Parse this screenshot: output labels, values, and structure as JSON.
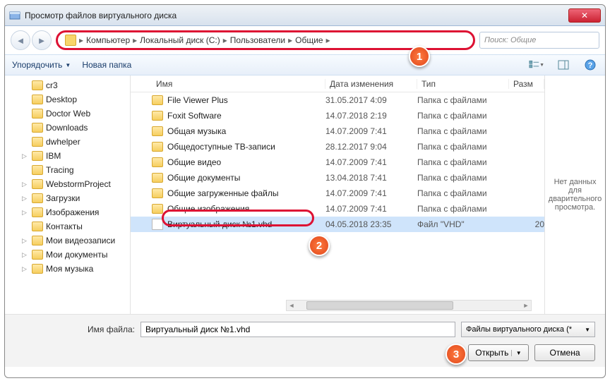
{
  "window": {
    "title": "Просмотр файлов виртуального диска"
  },
  "breadcrumb": [
    "Компьютер",
    "Локальный диск (C:)",
    "Пользователи",
    "Общие"
  ],
  "search": {
    "placeholder": "Поиск: Общие"
  },
  "toolbar": {
    "organize": "Упорядочить",
    "newfolder": "Новая папка"
  },
  "columns": {
    "name": "Имя",
    "modified": "Дата изменения",
    "type": "Тип",
    "size": "Разм"
  },
  "tree": [
    {
      "label": "cr3",
      "lvl": 1
    },
    {
      "label": "Desktop",
      "lvl": 1
    },
    {
      "label": "Doctor Web",
      "lvl": 1
    },
    {
      "label": "Downloads",
      "lvl": 1
    },
    {
      "label": "dwhelper",
      "lvl": 1
    },
    {
      "label": "IBM",
      "lvl": 1,
      "exp": true
    },
    {
      "label": "Tracing",
      "lvl": 1
    },
    {
      "label": "WebstormProject",
      "lvl": 1,
      "exp": true
    },
    {
      "label": "Загрузки",
      "lvl": 1,
      "exp": true
    },
    {
      "label": "Изображения",
      "lvl": 1,
      "exp": true
    },
    {
      "label": "Контакты",
      "lvl": 1
    },
    {
      "label": "Мои видеозаписи",
      "lvl": 1,
      "exp": true
    },
    {
      "label": "Мои документы",
      "lvl": 1,
      "exp": true
    },
    {
      "label": "Моя музыка",
      "lvl": 1,
      "exp": true
    }
  ],
  "files": [
    {
      "name": "File Viewer Plus",
      "date": "31.05.2017 4:09",
      "type": "Папка с файлами",
      "folder": true
    },
    {
      "name": "Foxit Software",
      "date": "14.07.2018 2:19",
      "type": "Папка с файлами",
      "folder": true
    },
    {
      "name": "Общая музыка",
      "date": "14.07.2009 7:41",
      "type": "Папка с файлами",
      "folder": true
    },
    {
      "name": "Общедоступные ТВ-записи",
      "date": "28.12.2017 9:04",
      "type": "Папка с файлами",
      "folder": true
    },
    {
      "name": "Общие видео",
      "date": "14.07.2009 7:41",
      "type": "Папка с файлами",
      "folder": true
    },
    {
      "name": "Общие документы",
      "date": "13.04.2018 7:41",
      "type": "Папка с файлами",
      "folder": true
    },
    {
      "name": "Общие загруженные файлы",
      "date": "14.07.2009 7:41",
      "type": "Папка с файлами",
      "folder": true
    },
    {
      "name": "Общие изображения",
      "date": "14.07.2009 7:41",
      "type": "Папка с файлами",
      "folder": true
    },
    {
      "name": "Виртуальный диск №1.vhd",
      "date": "04.05.2018 23:35",
      "type": "Файл \"VHD\"",
      "size": "20",
      "folder": false,
      "selected": true
    }
  ],
  "preview": {
    "empty": "Нет данных для дварительного просмотра."
  },
  "footer": {
    "filename_label": "Имя файла:",
    "filename_value": "Виртуальный диск №1.vhd",
    "filter": "Файлы виртуального диска (*",
    "open": "Открыть",
    "cancel": "Отмена"
  },
  "callouts": [
    "1",
    "2",
    "3"
  ]
}
